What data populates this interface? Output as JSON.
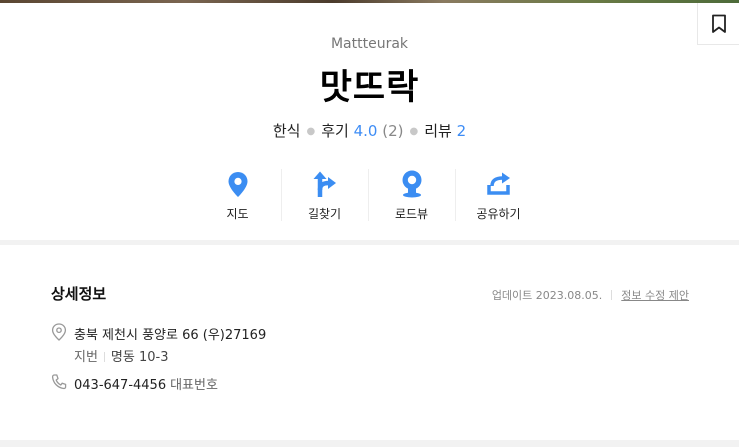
{
  "place": {
    "name_en": "Mattteurak",
    "name": "맛뜨락",
    "category": "한식",
    "review_label": "후기",
    "rating": "4.0",
    "rating_count": "(2)",
    "blog_review_label": "리뷰",
    "blog_review_count": "2"
  },
  "actions": [
    {
      "label": "지도",
      "icon": "map-pin-icon"
    },
    {
      "label": "길찾기",
      "icon": "directions-icon"
    },
    {
      "label": "로드뷰",
      "icon": "roadview-icon"
    },
    {
      "label": "공유하기",
      "icon": "share-icon"
    }
  ],
  "detail": {
    "title": "상세정보",
    "updated": "업데이트 2023.08.05.",
    "edit_link": "정보 수정 제안",
    "address": "충북 제천시 풍양로 66 (우)27169",
    "jibun_label": "지번",
    "jibun_value": "명동 10-3",
    "phone": "043-647-4456",
    "phone_tag": "대표번호"
  },
  "colors": {
    "accent": "#3d8cf5",
    "icon_blue": "#3b8df2"
  }
}
